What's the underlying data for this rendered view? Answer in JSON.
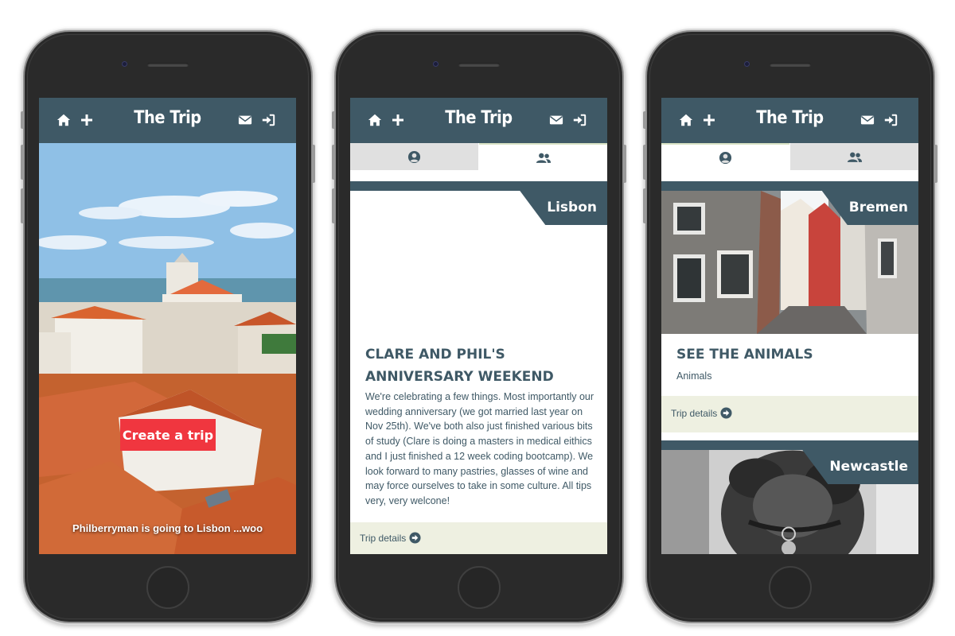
{
  "app": {
    "title": "The Trip",
    "colors": {
      "header": "#3f5966",
      "accent_red": "#f0363f",
      "footer": "#eef0e1",
      "tab_inactive": "#e0e0e0"
    },
    "header_icons": [
      "home-icon",
      "plus-icon",
      "envelope-icon",
      "sign-in-icon"
    ]
  },
  "screen1": {
    "create_label": "Create a trip",
    "caption": "Philberryman is going to Lisbon ...woo"
  },
  "screen2": {
    "tabs": {
      "first_icon": "user-circle-icon",
      "second_icon": "users-icon",
      "active": "second"
    },
    "card": {
      "city": "Lisbon",
      "title": "CLARE AND PHIL'S ANNIVERSARY WEEKEND",
      "description": "We're celebrating a few things. Most importantly our wedding anniversary (we got married last year on Nov 25th). We've both also just finished various bits of study (Clare is doing a masters in medical eithics and I just finished a 12 week coding bootcamp). We look forward to many pastries, glasses of wine and may force ourselves to take in some culture. All tips very, very welcone!",
      "link_label": "Trip details"
    }
  },
  "screen3": {
    "tabs": {
      "first_icon": "user-circle-icon",
      "second_icon": "users-icon",
      "active": "first"
    },
    "cards": [
      {
        "city": "Bremen",
        "title": "SEE THE ANIMALS",
        "subtitle": "Animals",
        "link_label": "Trip details"
      },
      {
        "city": "Newcastle"
      }
    ]
  }
}
